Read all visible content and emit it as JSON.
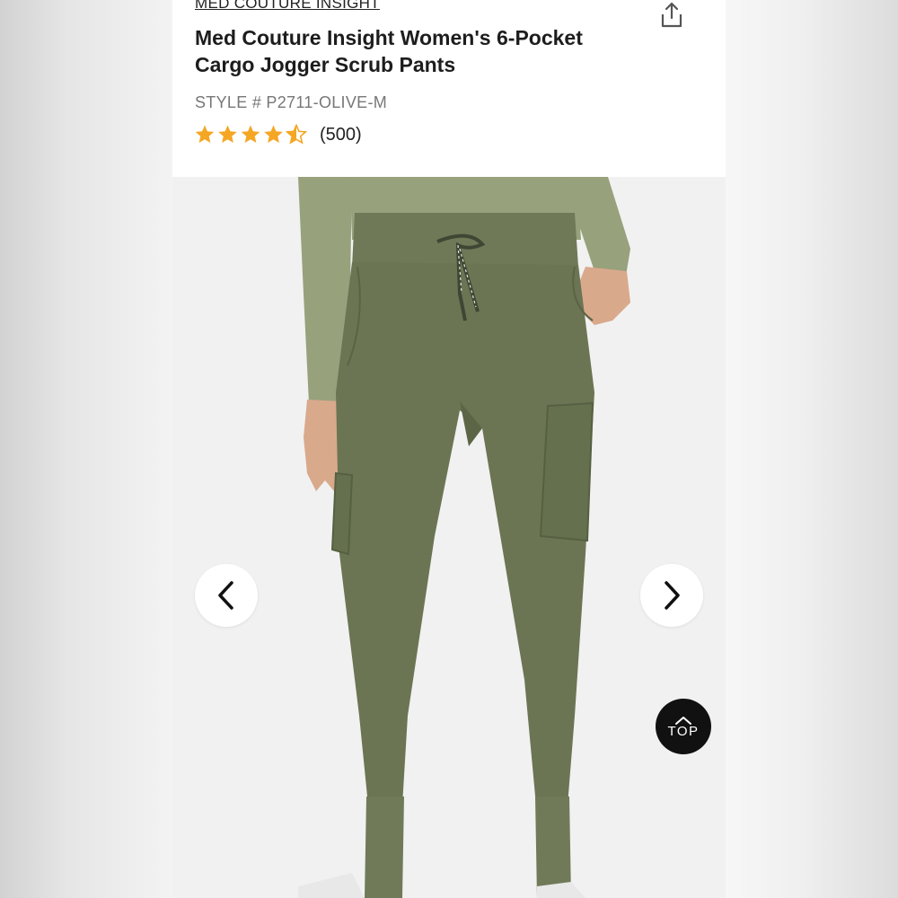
{
  "product": {
    "brand": "MED COUTURE INSIGHT",
    "title": "Med Couture Insight Women's 6-Pocket Cargo Jogger Scrub Pants",
    "style": "STYLE # P2711-OLIVE-M",
    "rating": {
      "stars": 4.5,
      "max": 5,
      "count_label": "(500)"
    }
  },
  "icons": {
    "share": "share-icon",
    "prev": "chevron-left-icon",
    "next": "chevron-right-icon",
    "top": "chevron-up-icon",
    "star": "star-icon"
  },
  "gallery": {
    "image_alt": "olive cargo jogger scrub pants on model"
  },
  "back_to_top": {
    "label": "TOP"
  },
  "colors": {
    "star": "#f5a623",
    "pants": "#6b7553",
    "shirt": "#97a17c",
    "top_button": "#111111"
  }
}
